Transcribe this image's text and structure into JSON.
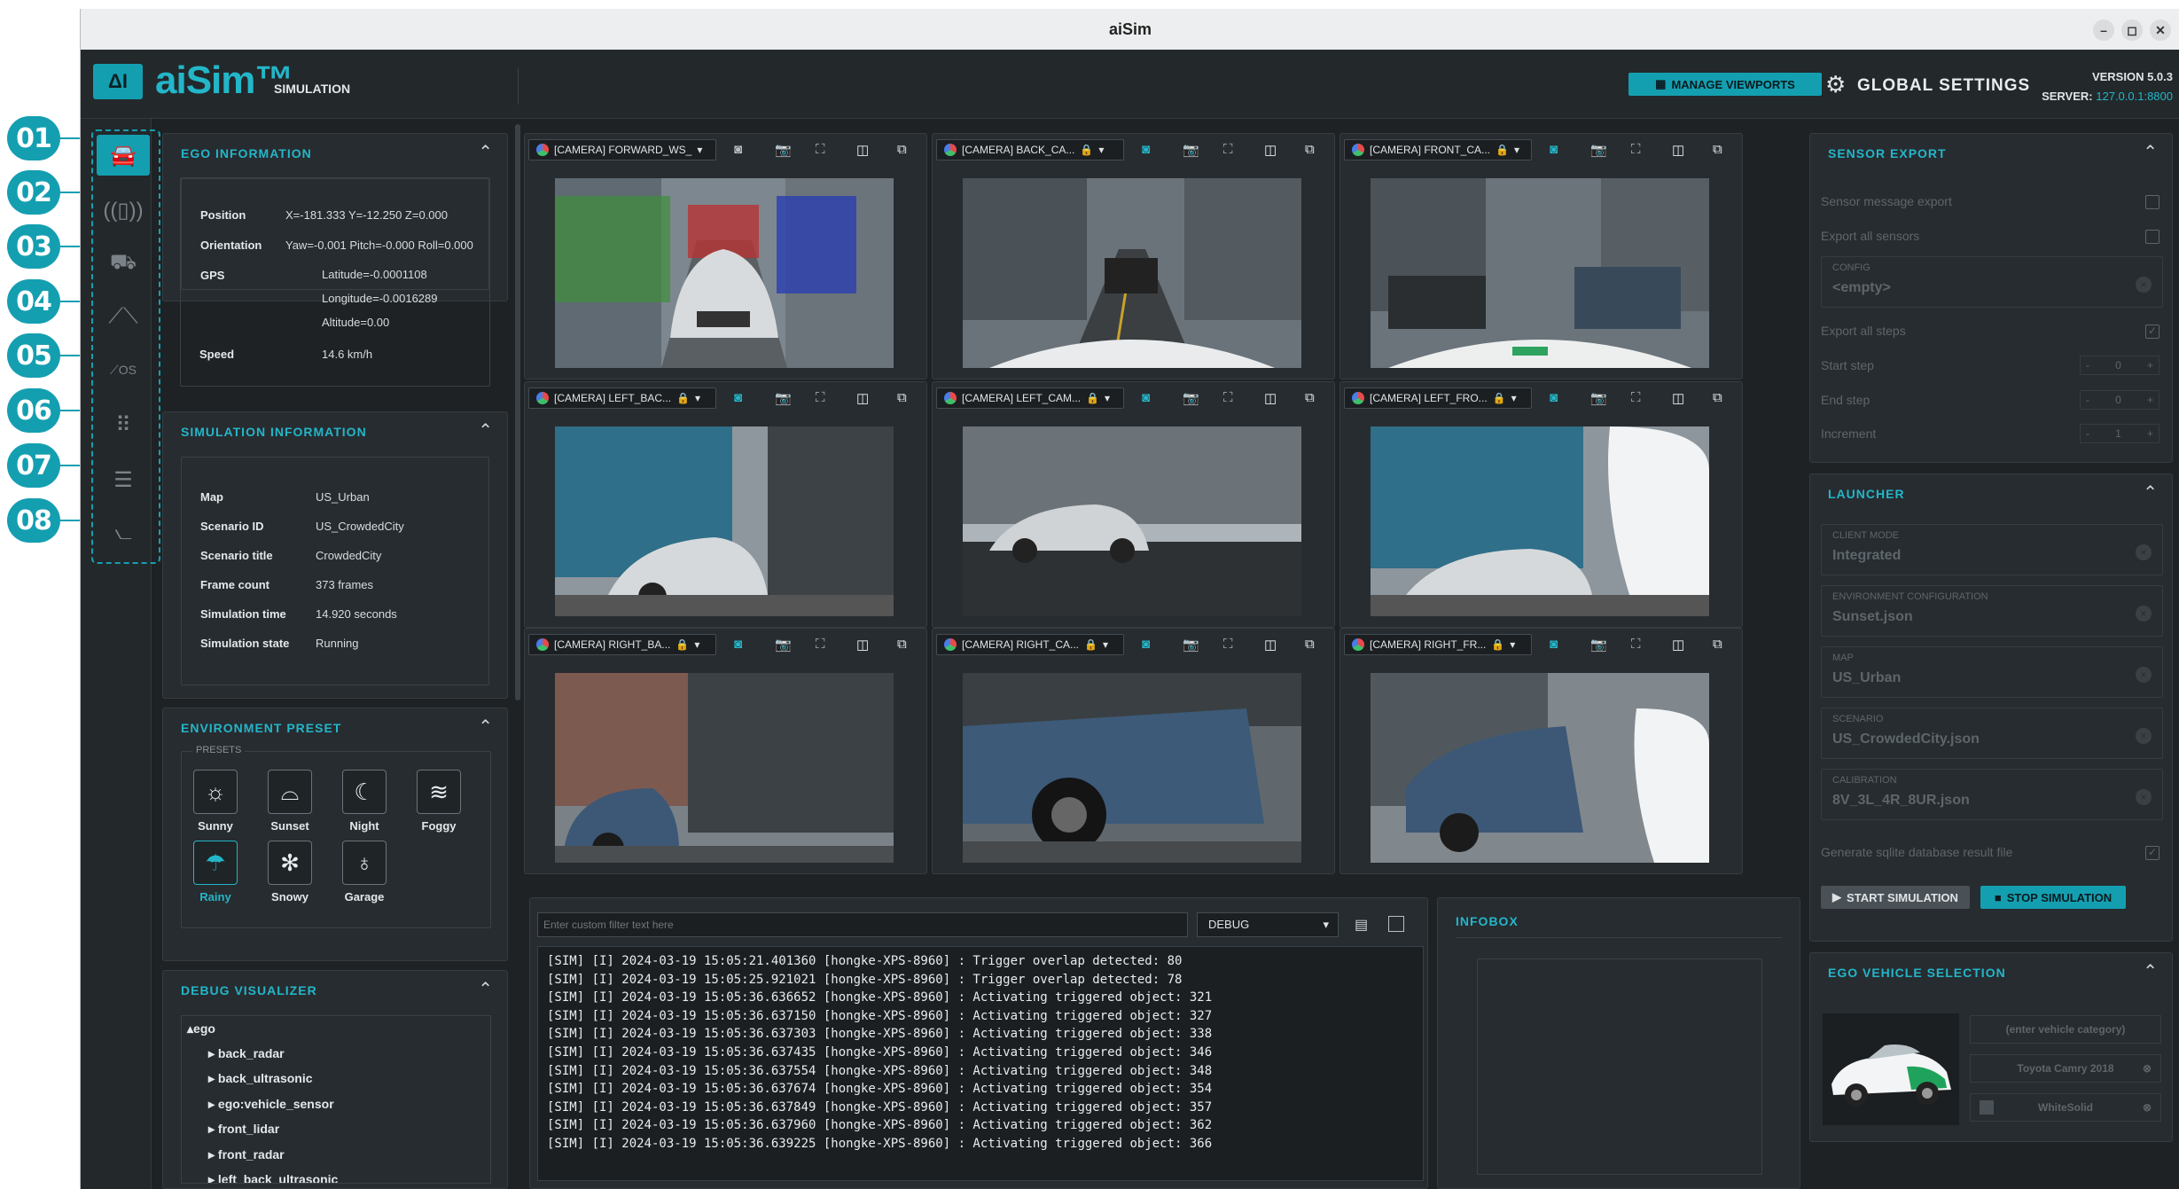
{
  "annotations": [
    "01",
    "02",
    "03",
    "04",
    "05",
    "06",
    "07",
    "08"
  ],
  "window": {
    "title": "aiSim"
  },
  "header": {
    "logo_mark": "ΔI",
    "logo": "aiSim™",
    "subtitle": "SIMULATION",
    "manage_viewports": "MANAGE VIEWPORTS",
    "global_settings": "GLOBAL SETTINGS",
    "version": "VERSION 5.0.3",
    "server_label": "SERVER:",
    "server": "127.0.0.1:8800"
  },
  "sidebar": {
    "icons": [
      "car-icon",
      "sensor-wave-icon",
      "vehicle-setup-icon",
      "road-icon",
      "road-os-icon",
      "apps-grid-icon",
      "network-icon",
      "chart-icon"
    ],
    "active_index": 0,
    "road_os_label": "OS"
  },
  "ego_info": {
    "title": "EGO INFORMATION",
    "position_label": "Position",
    "position": "X=-181.333 Y=-12.250 Z=0.000",
    "orientation_label": "Orientation",
    "orientation": "Yaw=-0.001 Pitch=-0.000 Roll=0.000",
    "gps_label": "GPS",
    "latitude": "Latitude=-0.0001108",
    "longitude": "Longitude=-0.0016289",
    "altitude": "Altitude=0.00",
    "speed_label": "Speed",
    "speed": "14.6 km/h"
  },
  "sim_info": {
    "title": "SIMULATION INFORMATION",
    "rows": [
      {
        "k": "Map",
        "v": "US_Urban"
      },
      {
        "k": "Scenario ID",
        "v": "US_CrowdedCity"
      },
      {
        "k": "Scenario title",
        "v": "CrowdedCity"
      },
      {
        "k": "Frame count",
        "v": "373  frames"
      },
      {
        "k": "Simulation time",
        "v": "14.920  seconds"
      },
      {
        "k": "Simulation state",
        "v": "Running"
      }
    ]
  },
  "env_preset": {
    "title": "ENVIRONMENT PRESET",
    "presets_label": "PRESETS",
    "presets": [
      {
        "label": "Sunny",
        "icon": "☼"
      },
      {
        "label": "Sunset",
        "icon": "⌓"
      },
      {
        "label": "Night",
        "icon": "☾"
      },
      {
        "label": "Foggy",
        "icon": "≋"
      },
      {
        "label": "Rainy",
        "icon": "☂"
      },
      {
        "label": "Snowy",
        "icon": "✻"
      },
      {
        "label": "Garage",
        "icon": "♁"
      }
    ],
    "selected": "Rainy"
  },
  "debug_vis": {
    "title": "DEBUG VISUALIZER",
    "tree": [
      "▴ego",
      "▸ back_radar",
      "▸ back_ultrasonic",
      "▸ ego:vehicle_sensor",
      "▸ front_lidar",
      "▸ front_radar",
      "▸ left_back_ultrasonic"
    ]
  },
  "viewports": [
    {
      "camera": "[CAMERA]  FORWARD_WS_"
    },
    {
      "camera": "[CAMERA]  BACK_CA..."
    },
    {
      "camera": "[CAMERA]  FRONT_CA..."
    },
    {
      "camera": "[CAMERA]  LEFT_BAC..."
    },
    {
      "camera": "[CAMERA]  LEFT_CAM..."
    },
    {
      "camera": "[CAMERA]  LEFT_FRO..."
    },
    {
      "camera": "[CAMERA]  RIGHT_BA..."
    },
    {
      "camera": "[CAMERA]  RIGHT_CA..."
    },
    {
      "camera": "[CAMERA]  RIGHT_FR..."
    }
  ],
  "log": {
    "filter_placeholder": "Enter custom filter text here",
    "level": "DEBUG",
    "lines": [
      "[SIM] [I] 2024-03-19 15:05:21.401360 [hongke-XPS-8960] : Trigger overlap detected: 80",
      "[SIM] [I] 2024-03-19 15:05:25.921021 [hongke-XPS-8960] : Trigger overlap detected: 78",
      "[SIM] [I] 2024-03-19 15:05:36.636652 [hongke-XPS-8960] : Activating triggered object: 321",
      "[SIM] [I] 2024-03-19 15:05:36.637150 [hongke-XPS-8960] : Activating triggered object: 327",
      "[SIM] [I] 2024-03-19 15:05:36.637303 [hongke-XPS-8960] : Activating triggered object: 338",
      "[SIM] [I] 2024-03-19 15:05:36.637435 [hongke-XPS-8960] : Activating triggered object: 346",
      "[SIM] [I] 2024-03-19 15:05:36.637554 [hongke-XPS-8960] : Activating triggered object: 348",
      "[SIM] [I] 2024-03-19 15:05:36.637674 [hongke-XPS-8960] : Activating triggered object: 354",
      "[SIM] [I] 2024-03-19 15:05:36.637849 [hongke-XPS-8960] : Activating triggered object: 357",
      "[SIM] [I] 2024-03-19 15:05:36.637960 [hongke-XPS-8960] : Activating triggered object: 362",
      "[SIM] [I] 2024-03-19 15:05:36.639225 [hongke-XPS-8960] : Activating triggered object: 366"
    ]
  },
  "infobox": {
    "title": "INFOBOX"
  },
  "sensor_export": {
    "title": "SENSOR EXPORT",
    "msg_export": "Sensor message export",
    "export_all": "Export all sensors",
    "config_label": "CONFIG",
    "config_value": "<empty>",
    "export_steps": "Export all steps",
    "start_step": "Start step",
    "start_val": "0",
    "end_step": "End step",
    "end_val": "0",
    "increment": "Increment",
    "inc_val": "1"
  },
  "launcher": {
    "title": "LAUNCHER",
    "fields": [
      {
        "label": "CLIENT MODE",
        "value": "Integrated"
      },
      {
        "label": "ENVIRONMENT CONFIGURATION",
        "value": "Sunset.json"
      },
      {
        "label": "MAP",
        "value": "US_Urban"
      },
      {
        "label": "SCENARIO",
        "value": "US_CrowdedCity.json"
      },
      {
        "label": "CALIBRATION",
        "value": "8V_3L_4R_8UR.json"
      }
    ],
    "sqlite": "Generate sqlite database result file",
    "start": "START SIMULATION",
    "stop": "STOP SIMULATION"
  },
  "ego_vehicle": {
    "title": "EGO VEHICLE SELECTION",
    "category_placeholder": "(enter vehicle category)",
    "model": "Toyota Camry 2018",
    "color": "WhiteSolid"
  }
}
